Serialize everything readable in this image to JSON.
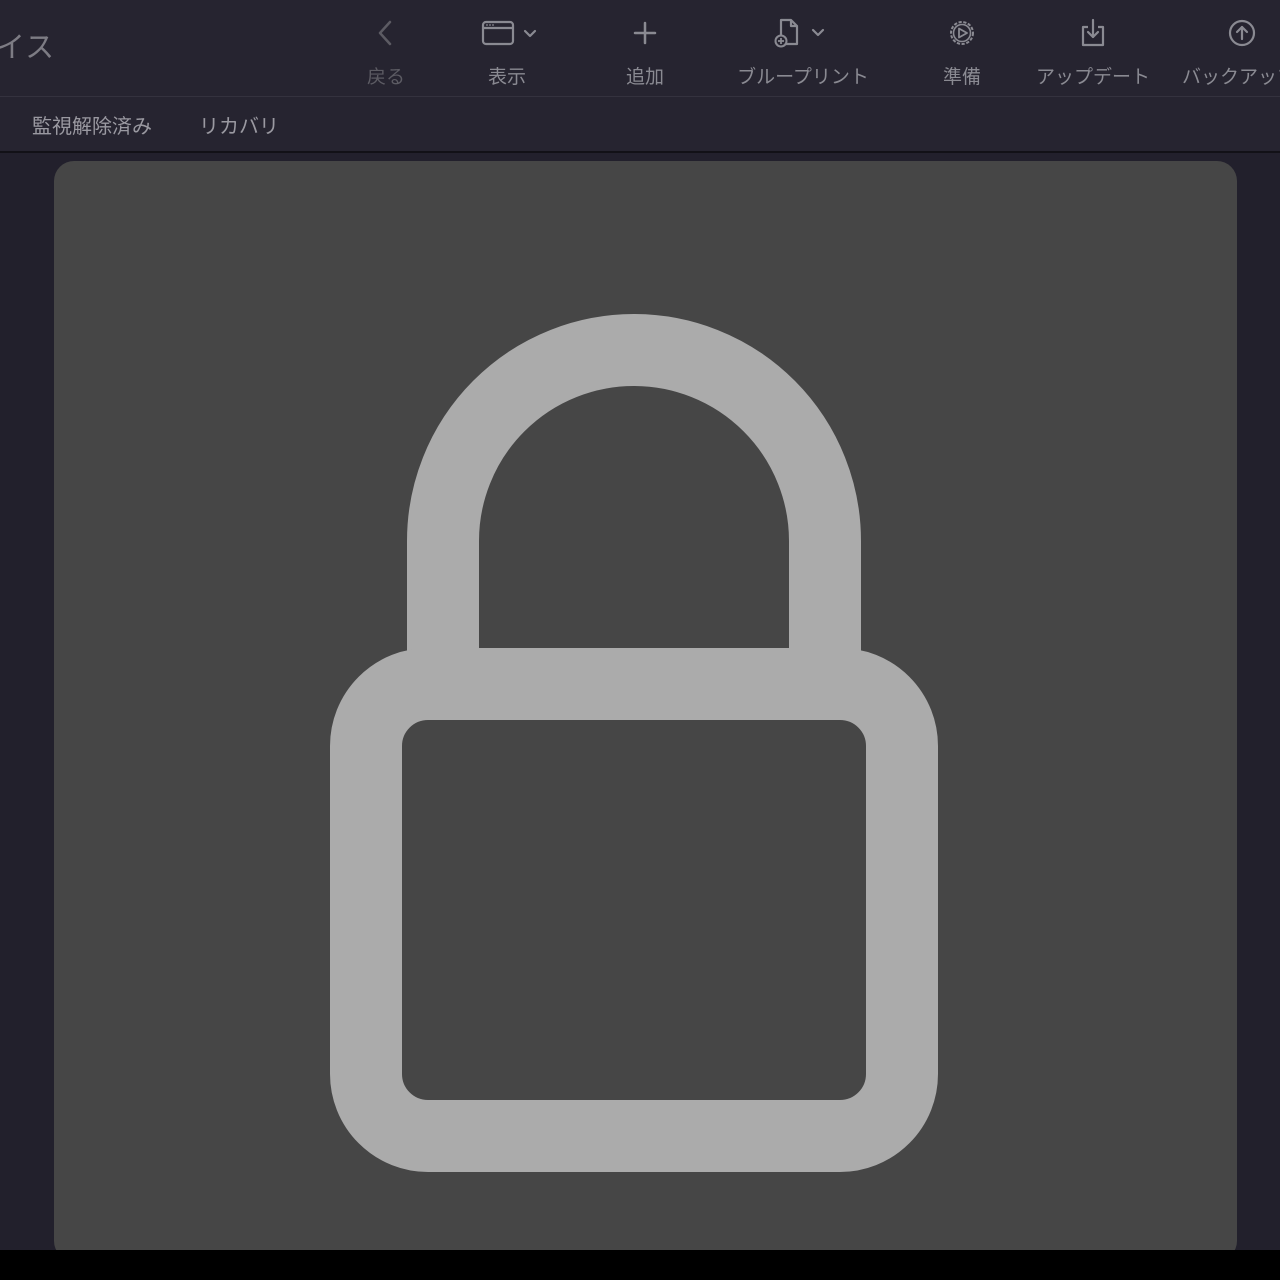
{
  "window": {
    "title_partial": "イス"
  },
  "toolbar": {
    "back_label": "戻る",
    "view_label": "表示",
    "add_label": "追加",
    "blueprint_label": "ブループリント",
    "prepare_label": "準備",
    "update_label": "アップデート",
    "backup_label": "バックアップ"
  },
  "subtabs": {
    "unsupervised": "監視解除済み",
    "recovery": "リカバリ"
  },
  "icons": {
    "back": "chevron-left-icon",
    "view": "window-icon",
    "add": "plus-icon",
    "blueprint": "document-add-icon",
    "prepare": "gear-play-icon",
    "update": "download-tray-icon",
    "backup": "upload-circle-icon",
    "main": "lock-icon"
  },
  "colors": {
    "background": "#22202c",
    "toolbar": "#262430",
    "panel": "#464646",
    "lock": "#ababab"
  }
}
